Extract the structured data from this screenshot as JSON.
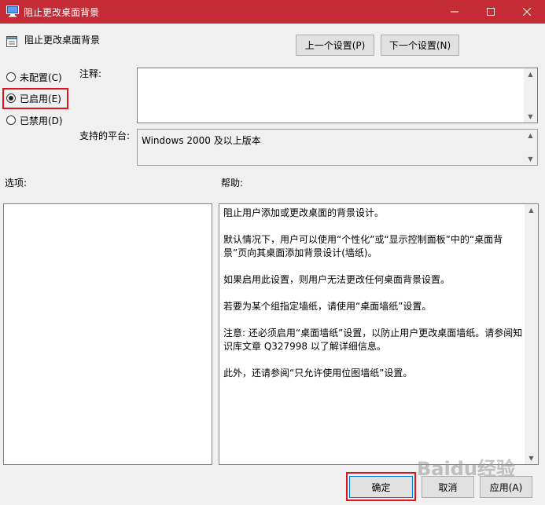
{
  "window": {
    "title": "阻止更改桌面背景",
    "controls": {
      "minimize": "─",
      "maximize": "☐",
      "close": "✕"
    }
  },
  "header": {
    "policy_title": "阻止更改桌面背景",
    "prev_button": "上一个设置(P)",
    "next_button": "下一个设置(N)"
  },
  "radios": {
    "not_configured": "未配置(C)",
    "enabled": "已启用(E)",
    "disabled": "已禁用(D)",
    "selected": "enabled"
  },
  "labels": {
    "comment": "注释:",
    "supported_platforms": "支持的平台:",
    "options": "选项:",
    "help": "帮助:"
  },
  "comment": {
    "value": ""
  },
  "supported_platforms": {
    "value": "Windows 2000 及以上版本"
  },
  "help_text": [
    "阻止用户添加或更改桌面的背景设计。",
    "默认情况下，用户可以使用“个性化”或“显示控制面板”中的“桌面背景”页向其桌面添加背景设计(墙纸)。",
    "如果启用此设置，则用户无法更改任何桌面背景设置。",
    "若要为某个组指定墙纸，请使用“桌面墙纸”设置。",
    "注意: 还必须启用“桌面墙纸”设置，以防止用户更改桌面墙纸。请参阅知识库文章 Q327998 以了解详细信息。",
    "此外，还请参阅“只允许使用位图墙纸”设置。"
  ],
  "footer": {
    "ok": "确定",
    "cancel": "取消",
    "apply": "应用(A)"
  },
  "watermark": "Baidu经验",
  "colors": {
    "titlebar": "#c42b35",
    "highlight": "#e0141e",
    "default_button_border": "#0078d7"
  }
}
